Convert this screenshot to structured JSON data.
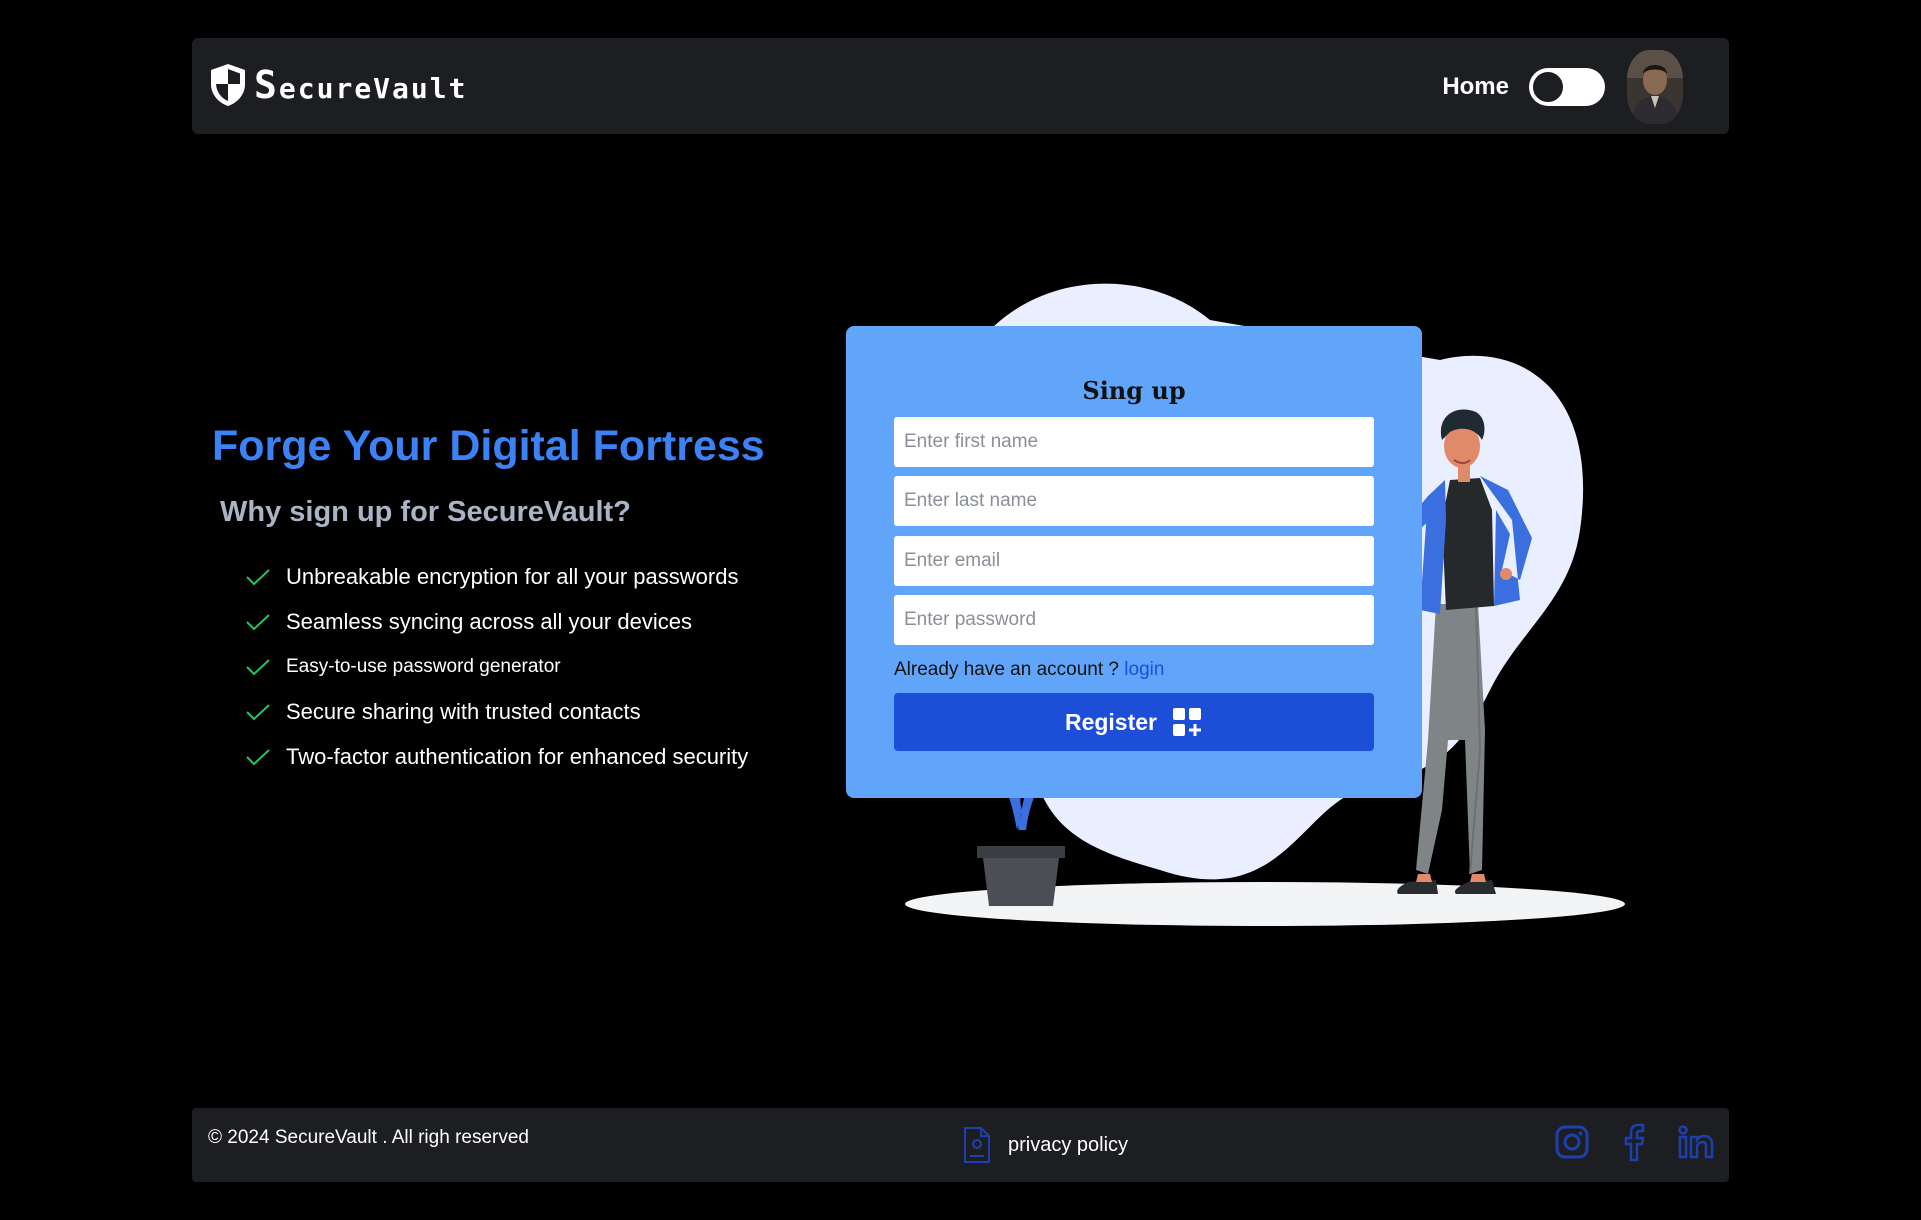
{
  "navbar": {
    "brand_first": "S",
    "brand_rest": "ecureVault",
    "home_label": "Home",
    "theme_toggle_on": false
  },
  "hero": {
    "title": "Forge Your Digital Fortress",
    "subtitle": "Why sign up for SecureVault?",
    "features": [
      "Unbreakable encryption for all your passwords",
      "Seamless syncing across all your devices",
      "Easy-to-use password generator",
      "Secure sharing with trusted contacts",
      "Two-factor authentication for enhanced security"
    ]
  },
  "form": {
    "title": "Sing up",
    "first_name_placeholder": "Enter first name",
    "last_name_placeholder": "Enter last name",
    "email_placeholder": "Enter email",
    "password_placeholder": "Enter password",
    "have_account_text": "Already have an account ?",
    "login_label": "login",
    "register_label": "Register"
  },
  "footer": {
    "copyright": "© 2024 SecureVault . All righ reserved",
    "privacy_label": "privacy policy",
    "social_icons": [
      "instagram-icon",
      "facebook-icon",
      "linkedin-icon"
    ]
  },
  "colors": {
    "accent": "#3b82f6",
    "card": "#60a5fa",
    "button": "#1d4ed8",
    "check": "#22c55e",
    "social": "#1e40af",
    "bar": "#1d1e22"
  }
}
